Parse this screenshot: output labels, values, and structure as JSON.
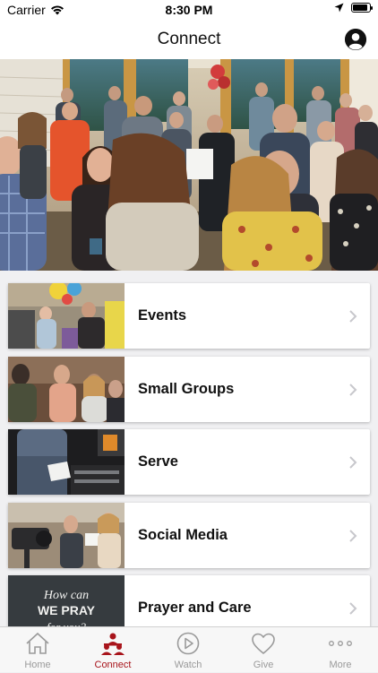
{
  "status_bar": {
    "carrier": "Carrier",
    "time": "8:30 PM",
    "battery_level": 0.9
  },
  "header": {
    "title": "Connect"
  },
  "menu": {
    "items": [
      {
        "label": "Events"
      },
      {
        "label": "Small Groups"
      },
      {
        "label": "Serve"
      },
      {
        "label": "Social Media"
      },
      {
        "label": "Prayer and Care",
        "thumb_text": "How can WE PRAY for you?"
      }
    ]
  },
  "tab_bar": {
    "tabs": [
      {
        "label": "Home",
        "icon": "home-icon"
      },
      {
        "label": "Connect",
        "icon": "people-icon",
        "active": true
      },
      {
        "label": "Watch",
        "icon": "play-icon"
      },
      {
        "label": "Give",
        "icon": "heart-icon"
      },
      {
        "label": "More",
        "icon": "more-icon"
      }
    ]
  },
  "colors": {
    "accent": "#a8141b",
    "inactive": "#9a9a9a",
    "background": "#f0f0f2"
  }
}
